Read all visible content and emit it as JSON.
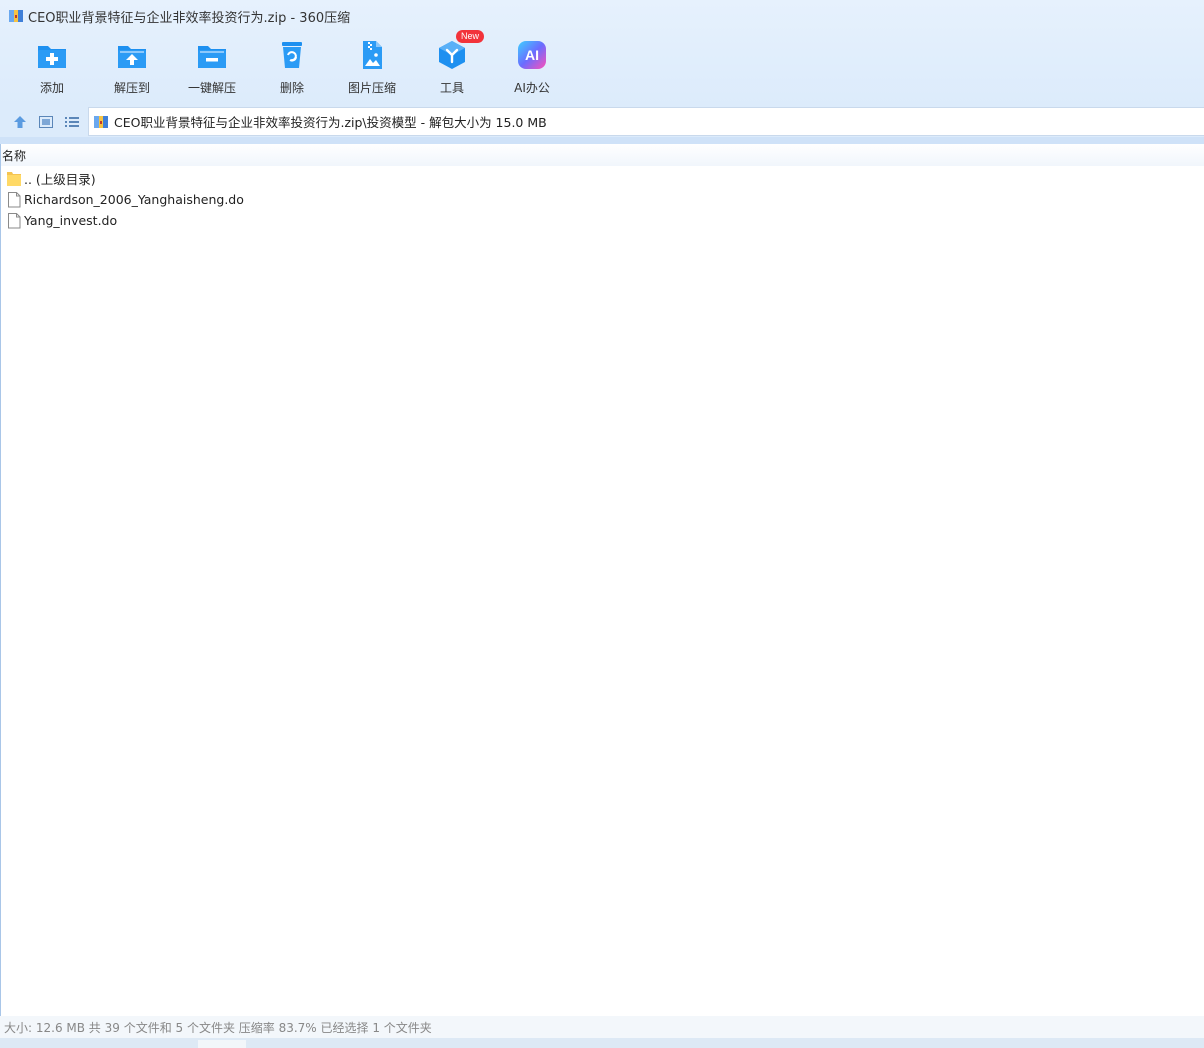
{
  "window": {
    "title": "CEO职业背景特征与企业非效率投资行为.zip - 360压缩"
  },
  "toolbar": [
    {
      "label": "添加",
      "icon": "add-folder-icon"
    },
    {
      "label": "解压到",
      "icon": "extract-to-icon"
    },
    {
      "label": "一键解压",
      "icon": "one-click-extract-icon"
    },
    {
      "label": "删除",
      "icon": "trash-icon"
    },
    {
      "label": "图片压缩",
      "icon": "image-compress-icon"
    },
    {
      "label": "工具",
      "icon": "tools-cube-icon",
      "badge": "New"
    },
    {
      "label": "AI办公",
      "icon": "ai-office-icon",
      "icon_text": "AI"
    }
  ],
  "address": {
    "path": "CEO职业背景特征与企业非效率投资行为.zip\\投资模型 - 解包大小为 15.0 MB"
  },
  "list": {
    "column_name": "名称",
    "items": [
      {
        "name": ".. (上级目录)",
        "type": "folder"
      },
      {
        "name": "Richardson_2006_Yanghaisheng.do",
        "type": "file"
      },
      {
        "name": "Yang_invest.do",
        "type": "file"
      }
    ]
  },
  "status": {
    "text": "大小: 12.6 MB 共 39 个文件和 5 个文件夹 压缩率 83.7% 已经选择 1 个文件夹"
  },
  "colors": {
    "accent_blue": "#1e90f0",
    "header_bg": "#e6f1fd",
    "new_badge": "#f2333b",
    "folder_yellow": "#ffd966"
  }
}
